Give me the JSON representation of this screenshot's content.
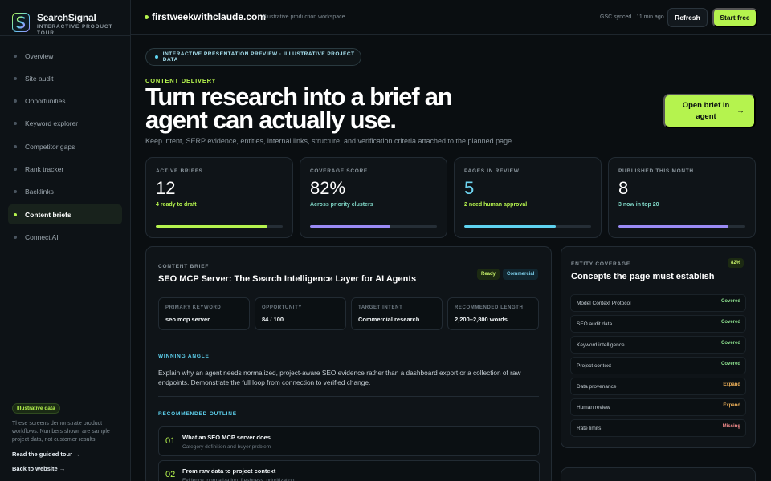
{
  "brand": {
    "name": "SearchSignal",
    "subtitle": "Interactive product tour"
  },
  "nav": [
    {
      "label": "Overview",
      "active": false
    },
    {
      "label": "Site audit",
      "active": false
    },
    {
      "label": "Opportunities",
      "active": false
    },
    {
      "label": "Keyword explorer",
      "active": false
    },
    {
      "label": "Competitor gaps",
      "active": false
    },
    {
      "label": "Rank tracker",
      "active": false
    },
    {
      "label": "Backlinks",
      "active": false
    },
    {
      "label": "Content briefs",
      "active": true
    },
    {
      "label": "Connect AI",
      "active": false
    }
  ],
  "sidebar_footer": {
    "badge": "Illustrative data",
    "note": "These screens demonstrate product workflows. Numbers shown are sample project data, not customer results.",
    "link_tour": "Read the guided tour →",
    "link_site": "Back to website →"
  },
  "topbar": {
    "domain": "firstweekwithclaude.com",
    "workspace": "Illustrative production workspace",
    "sync_status": "GSC synced · 11 min ago",
    "refresh_label": "Refresh",
    "start_label": "Start free"
  },
  "hero": {
    "preview_pill": "INTERACTIVE PRESENTATION PREVIEW · ILLUSTRATIVE PROJECT DATA",
    "eyebrow": "CONTENT DELIVERY",
    "title": "Turn research into a brief an agent can actually use.",
    "subtitle": "Keep intent, SERP evidence, entities, internal links, structure, and verification criteria attached to the planned page.",
    "cta_label": "Open brief in agent",
    "cta_arrow": "→"
  },
  "stats": [
    {
      "label": "ACTIVE BRIEFS",
      "value": "12",
      "note": "4 ready to draft",
      "progress": 0.88,
      "color": "#b5f34e"
    },
    {
      "label": "COVERAGE SCORE",
      "value": "82%",
      "note": "Across priority clusters",
      "progress": 0.63,
      "color": "#9a8af5"
    },
    {
      "label": "PAGES IN REVIEW",
      "value": "5",
      "note": "2 need human approval",
      "progress": 0.72,
      "color": "#5ed3f0"
    },
    {
      "label": "PUBLISHED THIS MONTH",
      "value": "8",
      "note": "3 now in top 20",
      "progress": 0.87,
      "color": "#9a8af5"
    }
  ],
  "brief": {
    "eyebrow": "CONTENT BRIEF",
    "title": "SEO MCP Server: The Search Intelligence Layer for AI Agents",
    "tag_ready": "Ready",
    "tag_type": "Commercial",
    "fields": [
      {
        "label": "PRIMARY KEYWORD",
        "value": "seo mcp server"
      },
      {
        "label": "OPPORTUNITY",
        "value": "84 / 100"
      },
      {
        "label": "TARGET INTENT",
        "value": "Commercial research"
      },
      {
        "label": "RECOMMENDED LENGTH",
        "value": "2,200–2,800 words"
      }
    ],
    "angle_label": "WINNING ANGLE",
    "angle_text": "Explain why an agent needs normalized, project-aware SEO evidence rather than a dashboard export or a collection of raw endpoints. Demonstrate the full loop from connection to verified change.",
    "outline_label": "RECOMMENDED OUTLINE",
    "outline": [
      {
        "num": "01",
        "title": "What an SEO MCP server does",
        "desc": "Category definition and buyer problem"
      },
      {
        "num": "02",
        "title": "From raw data to project context",
        "desc": "Evidence, normalization, freshness, prioritization"
      }
    ]
  },
  "entity": {
    "eyebrow": "ENTITY COVERAGE",
    "title": "Concepts the page must establish",
    "percent": "82%",
    "rows": [
      {
        "name": "Model Context Protocol",
        "status": "Covered",
        "kind": "covered"
      },
      {
        "name": "SEO audit data",
        "status": "Covered",
        "kind": "covered"
      },
      {
        "name": "Keyword intelligence",
        "status": "Covered",
        "kind": "covered"
      },
      {
        "name": "Project context",
        "status": "Covered",
        "kind": "covered"
      },
      {
        "name": "Data provenance",
        "status": "Expand",
        "kind": "expand"
      },
      {
        "name": "Human review",
        "status": "Expand",
        "kind": "expand"
      },
      {
        "name": "Rate limits",
        "status": "Missing",
        "kind": "missing"
      }
    ]
  }
}
